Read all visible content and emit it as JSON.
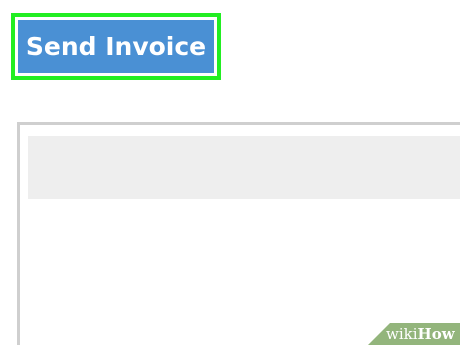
{
  "toolbar": {
    "send_invoice_label": "Send Invoice"
  },
  "watermark": {
    "prefix": "wiki",
    "suffix": "How"
  },
  "colors": {
    "button_background": "#4a90d4",
    "highlight_outline": "#22ee22",
    "panel_border": "#cfcfcf",
    "panel_header": "#eeeeee",
    "watermark_badge": "#93b57c"
  }
}
